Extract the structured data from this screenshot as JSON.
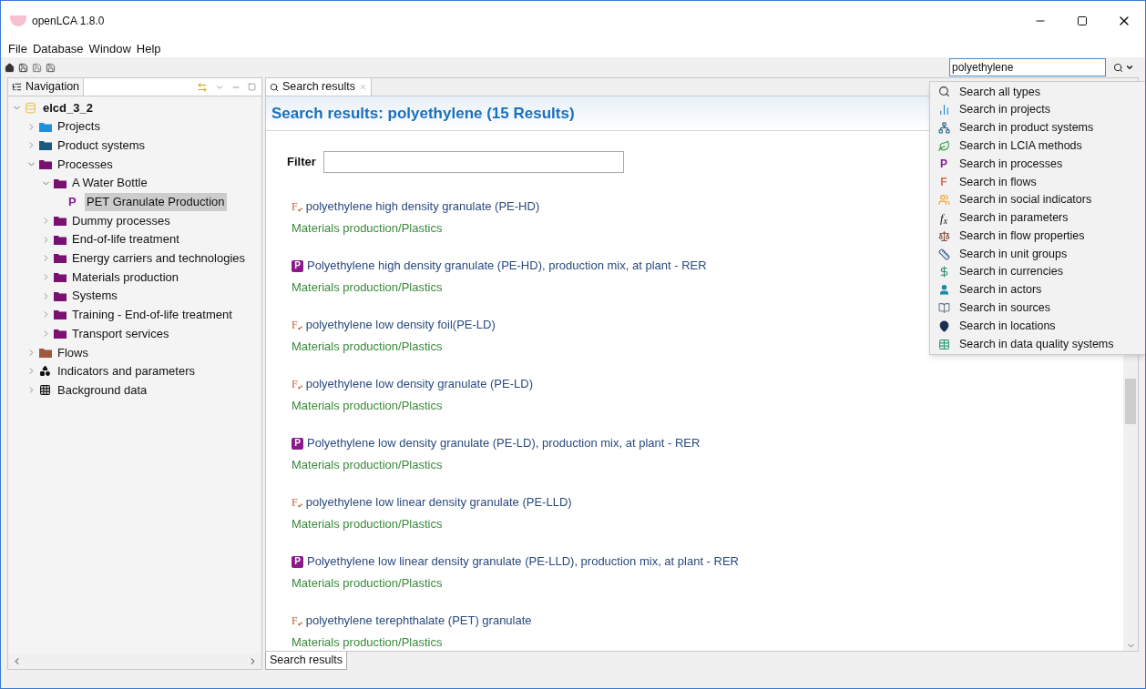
{
  "window": {
    "title": "openLCA 1.8.0"
  },
  "menu": [
    "File",
    "Database",
    "Window",
    "Help"
  ],
  "search": {
    "value": "polyethylene"
  },
  "navigation": {
    "title": "Navigation",
    "tree": [
      {
        "label": "elcd_3_2",
        "kind": "database",
        "expanded": true,
        "children": [
          {
            "label": "Projects",
            "kind": "folder",
            "color": "#1e90e0",
            "expanded": false
          },
          {
            "label": "Product systems",
            "kind": "folder",
            "color": "#1a5a80",
            "expanded": false
          },
          {
            "label": "Processes",
            "kind": "folder",
            "color": "#7a1070",
            "expanded": true,
            "children": [
              {
                "label": "A Water Bottle",
                "kind": "folder",
                "color": "#7a1070",
                "expanded": true,
                "children": [
                  {
                    "label": "PET Granulate Production",
                    "kind": "process",
                    "icon": "P",
                    "selected": true
                  }
                ]
              },
              {
                "label": "Dummy processes",
                "kind": "folder",
                "color": "#7a1070",
                "expanded": false
              },
              {
                "label": "End-of-life treatment",
                "kind": "folder",
                "color": "#7a1070",
                "expanded": false
              },
              {
                "label": "Energy carriers and technologies",
                "kind": "folder",
                "color": "#7a1070",
                "expanded": false
              },
              {
                "label": "Materials production",
                "kind": "folder",
                "color": "#7a1070",
                "expanded": false
              },
              {
                "label": "Systems",
                "kind": "folder",
                "color": "#7a1070",
                "expanded": false
              },
              {
                "label": "Training - End-of-life treatment",
                "kind": "folder",
                "color": "#7a1070",
                "expanded": false
              },
              {
                "label": "Transport services",
                "kind": "folder",
                "color": "#7a1070",
                "expanded": false
              }
            ]
          },
          {
            "label": "Flows",
            "kind": "folder",
            "color": "#a0583a",
            "expanded": false
          },
          {
            "label": "Indicators and parameters",
            "kind": "indicators",
            "expanded": false
          },
          {
            "label": "Background data",
            "kind": "background",
            "expanded": false
          }
        ]
      }
    ]
  },
  "editor": {
    "tab": "Search results",
    "heading": "Search results: polyethylene (15 Results)",
    "filter": {
      "label": "Filter"
    },
    "results": [
      {
        "kind": "flow",
        "icon": "F",
        "name": "polyethylene high density granulate (PE-HD)",
        "path": "Materials production/Plastics"
      },
      {
        "kind": "process",
        "icon": "P",
        "name": "Polyethylene high density granulate (PE-HD), production mix, at plant - RER",
        "path": "Materials production/Plastics"
      },
      {
        "kind": "flow",
        "icon": "F",
        "name": "polyethylene low density foil(PE-LD)",
        "path": "Materials production/Plastics"
      },
      {
        "kind": "flow",
        "icon": "F",
        "name": "polyethylene low density granulate (PE-LD)",
        "path": "Materials production/Plastics"
      },
      {
        "kind": "process",
        "icon": "P",
        "name": "Polyethylene low density granulate (PE-LD), production mix, at plant - RER",
        "path": "Materials production/Plastics"
      },
      {
        "kind": "flow",
        "icon": "F",
        "name": "polyethylene low linear density granulate (PE-LLD)",
        "path": "Materials production/Plastics"
      },
      {
        "kind": "process",
        "icon": "P",
        "name": "Polyethylene low linear density granulate (PE-LLD), production mix, at plant - RER",
        "path": "Materials production/Plastics"
      },
      {
        "kind": "flow",
        "icon": "F",
        "name": "polyethylene terephthalate (PET) granulate",
        "path": "Materials production/Plastics"
      }
    ],
    "bottom_tab": "Search results"
  },
  "search_menu": [
    {
      "kind": "all",
      "label": "Search all types"
    },
    {
      "kind": "projects",
      "label": "Search in projects"
    },
    {
      "kind": "product_systems",
      "label": "Search in product systems"
    },
    {
      "kind": "lcia",
      "label": "Search in LCIA methods"
    },
    {
      "kind": "processes",
      "icon": "P",
      "label": "Search in processes"
    },
    {
      "kind": "flows",
      "icon": "F",
      "label": "Search in flows"
    },
    {
      "kind": "social",
      "label": "Search in social indicators"
    },
    {
      "kind": "parameters",
      "icon": "f$_{x}$",
      "label": "Search in parameters"
    },
    {
      "kind": "flow_properties",
      "label": "Search in flow properties"
    },
    {
      "kind": "unit_groups",
      "label": "Search in unit groups"
    },
    {
      "kind": "currencies",
      "label": "Search in currencies"
    },
    {
      "kind": "actors",
      "label": "Search in actors"
    },
    {
      "kind": "sources",
      "label": "Search in sources"
    },
    {
      "kind": "locations",
      "label": "Search in locations"
    },
    {
      "kind": "dq",
      "label": "Search in data quality systems"
    }
  ]
}
